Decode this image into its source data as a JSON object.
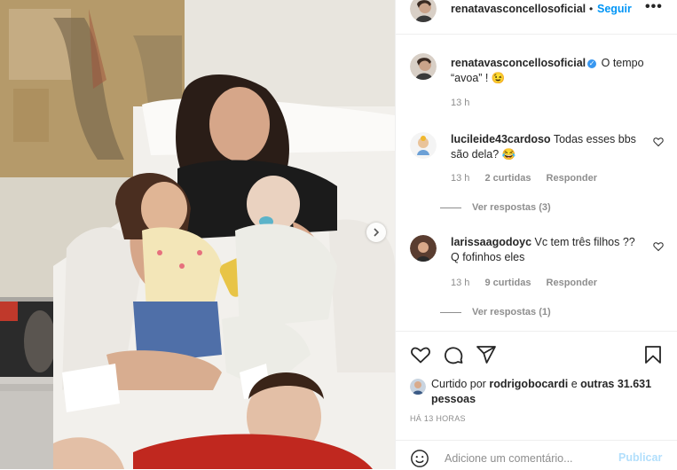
{
  "post": {
    "author": "renatavasconcellosoficial",
    "follow_label": "Seguir",
    "separator": "•",
    "more_label": "•••",
    "caption_text": "O tempo “avoa” ! 😉",
    "caption_time": "13 h",
    "verified_mark": "✓"
  },
  "comments": [
    {
      "user": "lucileide43cardoso",
      "text": "Todas esses bbs são dela? 😂",
      "time": "13 h",
      "likes": "2 curtidas",
      "reply": "Responder",
      "view_replies": "Ver respostas (3)"
    },
    {
      "user": "larissaagodoyc",
      "text": "Vc tem três filhos ?? Q fofinhos eles",
      "time": "13 h",
      "likes": "9 curtidas",
      "reply": "Responder",
      "view_replies": "Ver respostas (1)"
    }
  ],
  "likes": {
    "prefix": "Curtido por",
    "user": "rodrigobocardi",
    "conj": "e",
    "others": "outras 31.631 pessoas"
  },
  "time_ago": "HÁ 13 HORAS",
  "add_comment": {
    "placeholder": "Adicione um comentário...",
    "post_label": "Publicar"
  },
  "icons": {
    "more": "more-options-icon",
    "heart": "heart-icon",
    "comment": "comment-icon",
    "share": "paper-plane-icon",
    "save": "bookmark-icon",
    "emoji": "emoji-icon",
    "next": "chevron-right-icon"
  },
  "colors": {
    "link_blue": "#0095f6",
    "verified_blue": "#3897f0",
    "muted": "#8e8e8e",
    "post_disabled": "#b2dffc"
  }
}
